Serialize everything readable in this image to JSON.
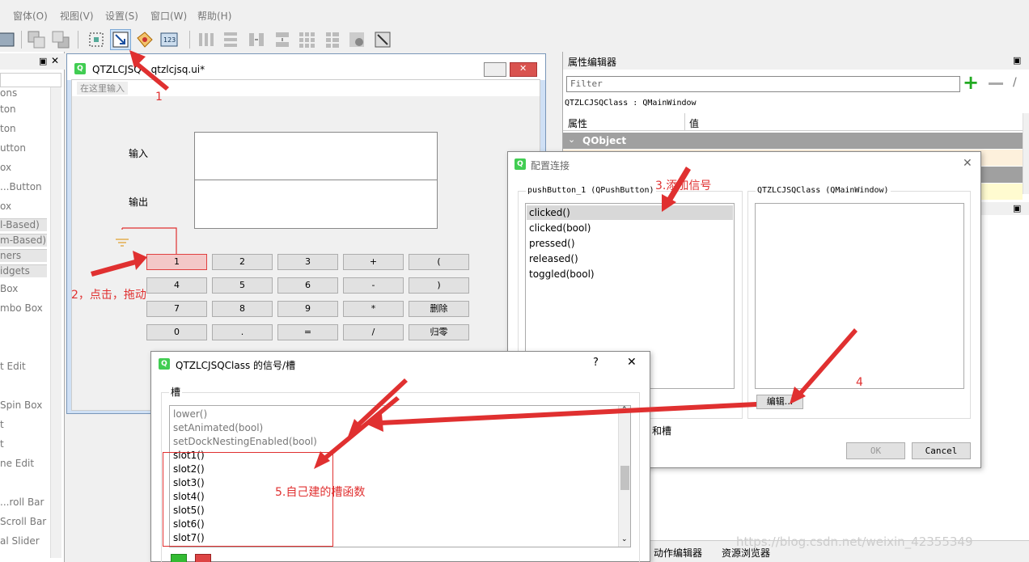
{
  "menubar": {
    "items": [
      "窗体(O)",
      "视图(V)",
      "设置(S)",
      "窗口(W)",
      "帮助(H)"
    ]
  },
  "left_panel": {
    "items": [
      "ons",
      "ton",
      "ton",
      "utton",
      "ox",
      "...Button",
      "ox",
      "l-Based)",
      "m-Based)",
      "ners",
      "idgets",
      "Box",
      "mbo Box",
      "t Edit",
      "Spin Box",
      "t",
      "t",
      "ne Edit",
      "...roll Bar",
      "Scroll Bar",
      "al Slider"
    ]
  },
  "designer": {
    "window_title": "QTZLCJSQ - qtzlcjsq.ui*",
    "menu_placeholder": "在这里输入",
    "label_input": "输入",
    "label_output": "输出",
    "buttons": [
      [
        "1",
        "2",
        "3",
        "+",
        "("
      ],
      [
        "4",
        "5",
        "6",
        "-",
        ")"
      ],
      [
        "7",
        "8",
        "9",
        "*",
        "删除"
      ],
      [
        "0",
        ".",
        "=",
        "/",
        "归零"
      ]
    ]
  },
  "property_editor": {
    "title": "属性编辑器",
    "filter_placeholder": "Filter",
    "object_label": "QTZLCJSQClass : QMainWindow",
    "col_property": "属性",
    "col_value": "值",
    "group": "QObject"
  },
  "config_dialog": {
    "title": "配置连接",
    "left_group": "pushButton_1 (QPushButton)",
    "right_group": "QTZLCJSQClass (QMainWindow)",
    "signals": [
      "clicked()",
      "clicked(bool)",
      "pressed()",
      "released()",
      "toggled(bool)"
    ],
    "edit_button": "编辑...",
    "ok_button": "OK",
    "cancel_button": "Cancel",
    "partial_text": "和槽"
  },
  "slots_dialog": {
    "title": "QTZLCJSQClass 的信号/槽",
    "help": "?",
    "close": "✕",
    "group": "槽",
    "slots": [
      "lower()",
      "setAnimated(bool)",
      "setDockNestingEnabled(bool)",
      "slot1()",
      "slot2()",
      "slot3()",
      "slot4()",
      "slot5()",
      "slot6()",
      "slot7()"
    ]
  },
  "bottom_tabs": [
    "动作编辑器",
    "资源浏览器"
  ],
  "watermark": "https://blog.csdn.net/weixin_42355349",
  "annotations": {
    "a1": "1",
    "a2": "2，点击，拖动",
    "a3": "3.添加信号",
    "a4": "4",
    "a5": "5.自己建的槽函数"
  },
  "colors": {
    "annotation": "#e03030",
    "qt_green": "#41cd52"
  }
}
